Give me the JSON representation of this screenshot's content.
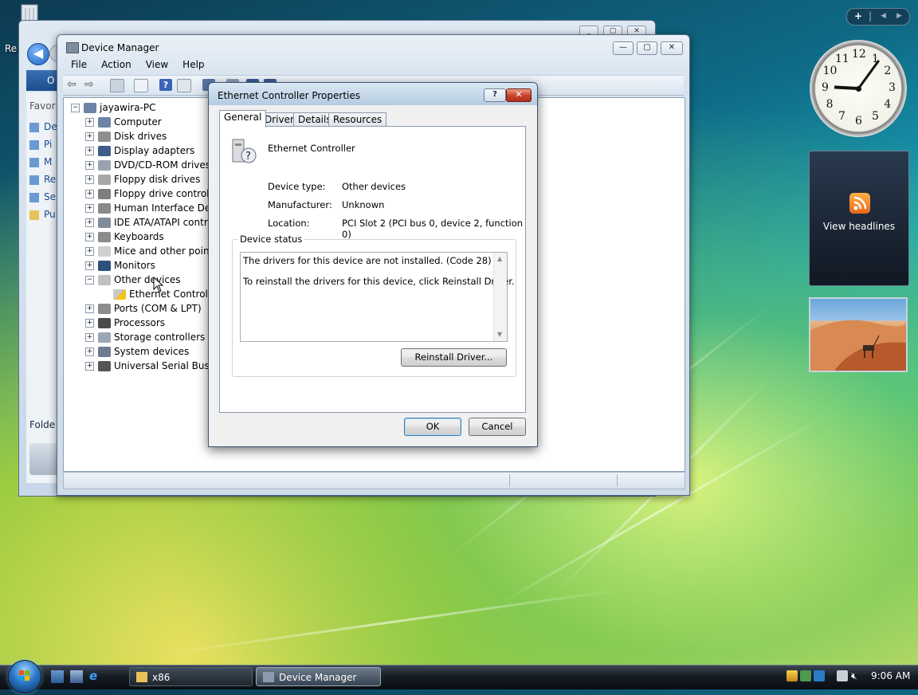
{
  "desktop": {
    "recycle_label": "Re",
    "colors": {
      "accent": "#1b5fb8",
      "close": "#c6412a"
    }
  },
  "back_window": {
    "toolbar_label": "O",
    "favorites_label": "Favor",
    "side_items": [
      "De",
      "Pi",
      "M",
      "Re",
      "Se",
      "Pu"
    ],
    "folders_label": "Folde"
  },
  "device_manager": {
    "title": "Device Manager",
    "menu": [
      "File",
      "Action",
      "View",
      "Help"
    ],
    "tree": {
      "root": "jayawira-PC",
      "items": [
        {
          "label": "Computer",
          "icon": "computer-icon",
          "expanded": false
        },
        {
          "label": "Disk drives",
          "icon": "disk-icon",
          "expanded": false
        },
        {
          "label": "Display adapters",
          "icon": "display-adapter-icon",
          "expanded": false
        },
        {
          "label": "DVD/CD-ROM drives",
          "icon": "dvd-icon",
          "expanded": false
        },
        {
          "label": "Floppy disk drives",
          "icon": "floppy-icon",
          "expanded": false
        },
        {
          "label": "Floppy drive controllers",
          "icon": "floppy-controller-icon",
          "expanded": false
        },
        {
          "label": "Human Interface Devices",
          "icon": "hid-icon",
          "expanded": false
        },
        {
          "label": "IDE ATA/ATAPI controllers",
          "icon": "ide-icon",
          "expanded": false
        },
        {
          "label": "Keyboards",
          "icon": "keyboard-icon",
          "expanded": false
        },
        {
          "label": "Mice and other pointing devices",
          "icon": "mouse-icon",
          "expanded": false
        },
        {
          "label": "Monitors",
          "icon": "monitor-icon",
          "expanded": false
        },
        {
          "label": "Other devices",
          "icon": "unknown-device-icon",
          "expanded": true
        },
        {
          "label": "Ports (COM & LPT)",
          "icon": "port-icon",
          "expanded": false
        },
        {
          "label": "Processors",
          "icon": "processor-icon",
          "expanded": false
        },
        {
          "label": "Storage controllers",
          "icon": "storage-icon",
          "expanded": false
        },
        {
          "label": "System devices",
          "icon": "system-icon",
          "expanded": false
        },
        {
          "label": "Universal Serial Bus controllers",
          "icon": "usb-icon",
          "expanded": false
        }
      ],
      "child": "Ethernet Controller"
    }
  },
  "dialog": {
    "title": "Ethernet Controller Properties",
    "help_btn": "?",
    "close_btn": "✕",
    "tabs": [
      "General",
      "Driver",
      "Details",
      "Resources"
    ],
    "device_name": "Ethernet Controller",
    "device_type_label": "Device type:",
    "device_type": "Other devices",
    "manufacturer_label": "Manufacturer:",
    "manufacturer": "Unknown",
    "location_label": "Location:",
    "location": "PCI Slot 2 (PCI bus 0, device 2, function 0)",
    "status_group": "Device status",
    "status_line1": "The drivers for this device are not installed. (Code 28)",
    "status_line2": "To reinstall the drivers for this device, click Reinstall Driver.",
    "reinstall_btn": "Reinstall Driver...",
    "ok_btn": "OK",
    "cancel_btn": "Cancel"
  },
  "gadgets": {
    "bar_plus": "+",
    "bar_prev": "◀",
    "bar_sep": "|",
    "bar_next": "▶",
    "feed_label": "View headlines",
    "clock_numbers": [
      "12",
      "1",
      "2",
      "3",
      "4",
      "5",
      "6",
      "7",
      "8",
      "9",
      "10",
      "11"
    ],
    "clock_time": "9:06"
  },
  "taskbar": {
    "buttons": [
      {
        "label": "x86",
        "icon": "folder-icon",
        "active": false
      },
      {
        "label": "Device Manager",
        "icon": "device-manager-icon",
        "active": true
      }
    ],
    "time": "9:06 AM"
  }
}
